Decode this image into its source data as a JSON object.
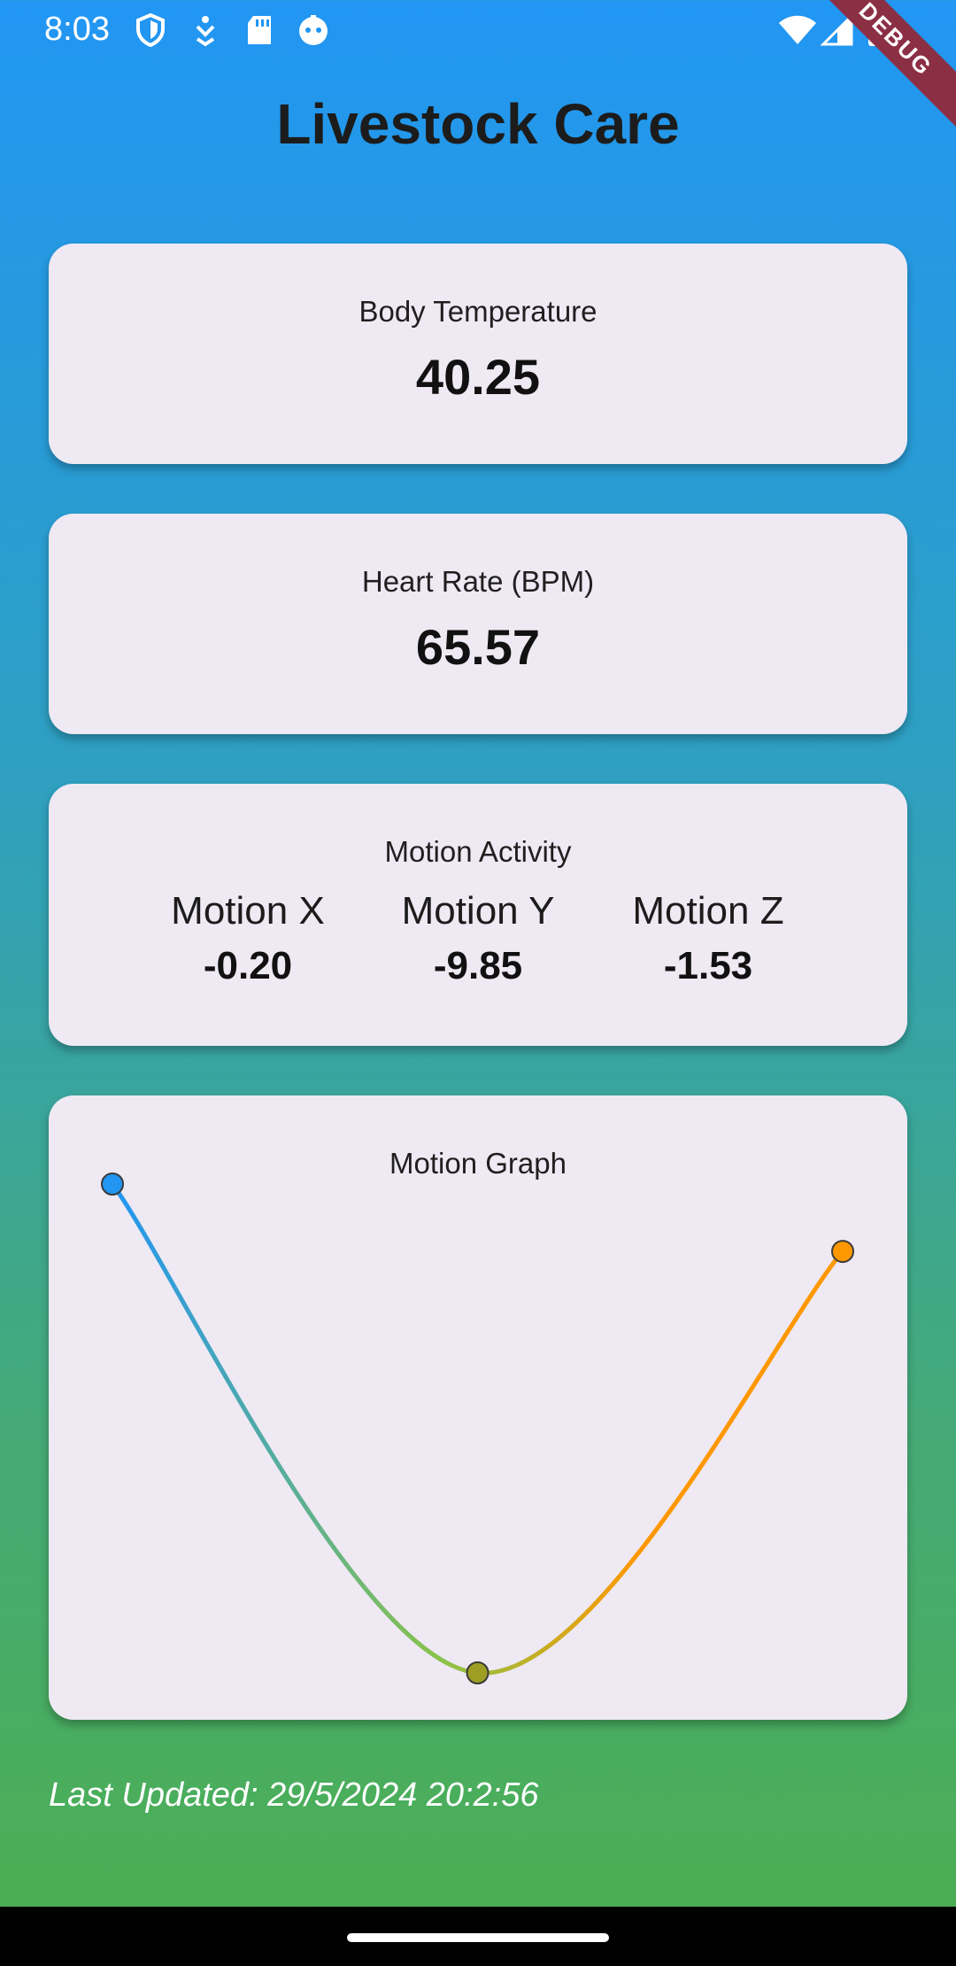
{
  "status_bar": {
    "time": "8:03",
    "left_icons": [
      "shield-icon",
      "download-icon",
      "sd-card-icon",
      "robot-icon"
    ],
    "right_icons": [
      "wifi-icon",
      "signal-icon",
      "battery-icon"
    ]
  },
  "debug_banner": "DEBUG",
  "app": {
    "title": "Livestock Care"
  },
  "body_temperature": {
    "label": "Body Temperature",
    "value": "40.25"
  },
  "heart_rate": {
    "label": "Heart Rate (BPM)",
    "value": "65.57"
  },
  "motion_activity": {
    "label": "Motion Activity",
    "axes": [
      {
        "name": "Motion X",
        "value": "-0.20"
      },
      {
        "name": "Motion Y",
        "value": "-9.85"
      },
      {
        "name": "Motion Z",
        "value": "-1.53"
      }
    ]
  },
  "motion_graph": {
    "label": "Motion Graph"
  },
  "chart_data": {
    "type": "line",
    "x": [
      0,
      1,
      2
    ],
    "series": [
      {
        "values": [
          -0.2,
          -9.85,
          -1.53
        ]
      }
    ],
    "ylim": [
      -9.85,
      -0.2
    ],
    "grid": false,
    "point_colors": [
      "#2196F3",
      "#9E9D24",
      "#FF9800"
    ],
    "line_gradient": [
      "#2196F3",
      "#8BC34A",
      "#FF9800"
    ]
  },
  "footer": {
    "last_updated": "Last Updated: 29/5/2024 20:2:56"
  },
  "colors": {
    "gradient_top": "#2196F3",
    "gradient_bottom": "#4CAF50",
    "card_background": "#EEE9F3",
    "debug_banner": "#8B2F45"
  }
}
